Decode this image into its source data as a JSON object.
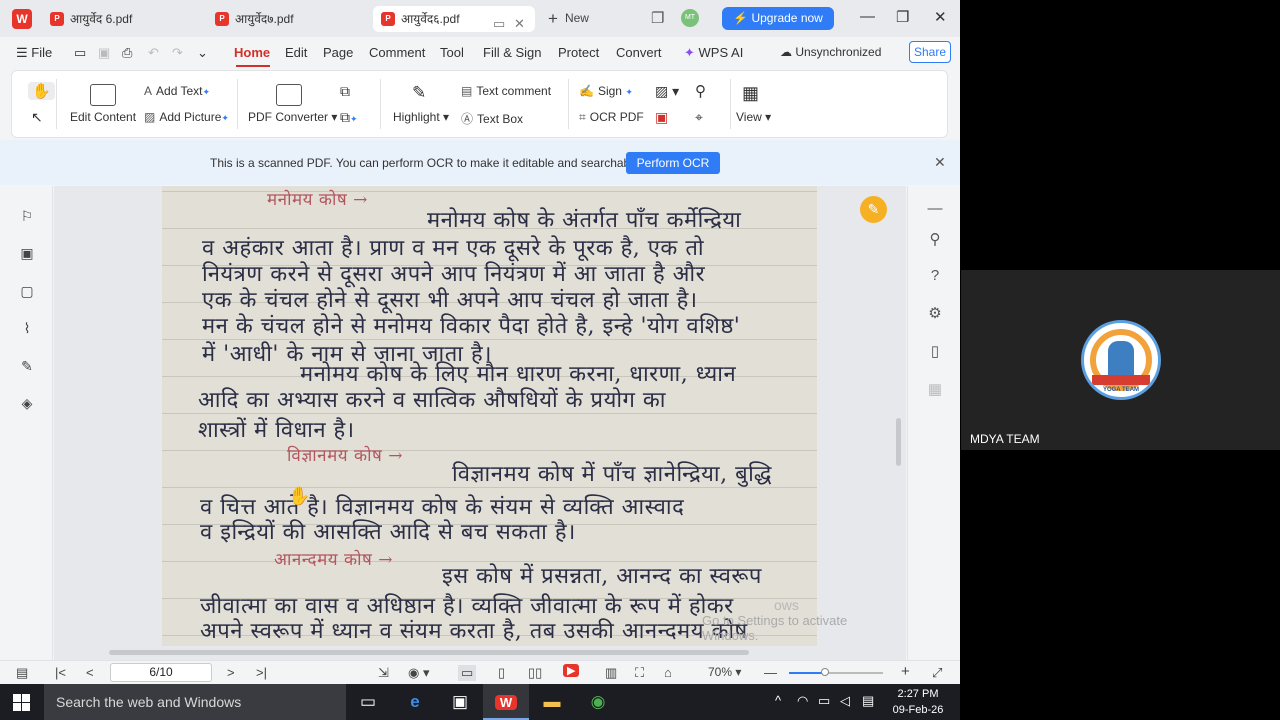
{
  "tabs": [
    {
      "label": "आयुर्वेद 6.pdf"
    },
    {
      "label": "आयुर्वेद७.pdf"
    },
    {
      "label": "आयुर्वेद६.pdf"
    }
  ],
  "new_tab_label": "New",
  "avatar_initials": "MT",
  "upgrade_label": "Upgrade now",
  "menu": {
    "file": "File",
    "items": [
      "Home",
      "Edit",
      "Page",
      "Comment",
      "Tool",
      "Fill & Sign",
      "Protect",
      "Convert"
    ],
    "wps_ai": "WPS AI",
    "sync": "Unsynchronized",
    "share": "Share"
  },
  "ribbon": {
    "edit_content": "Edit Content",
    "add_text": "Add Text",
    "add_picture": "Add Picture",
    "pdf_converter": "PDF Converter",
    "highlight": "Highlight",
    "text_comment": "Text comment",
    "text_box": "Text Box",
    "sign": "Sign",
    "ocr_pdf": "OCR PDF",
    "view": "View"
  },
  "banner": {
    "message": "This is a scanned PDF. You can perform OCR to make it editable and searchable.",
    "button": "Perform OCR"
  },
  "document": {
    "heading_1": "मनोमय कोष →",
    "lines_1": [
      "मनोमय कोष के अंतर्गत पाँच कर्मेन्द्रिया",
      "व अहंकार आता है। प्राण व मन एक दूसरे के पूरक है, एक तो",
      "नियंत्रण करने से दूसरा अपने आप नियंत्रण में आ जाता है और",
      "एक के चंचल होने से दूसरा भी अपने आप चंचल हो जाता है।",
      "मन के चंचल होने से मनोमय विकार पैदा होते है, इन्हे 'योग वशिष्ठ'",
      "में 'आधी' के नाम से जाना जाता है।",
      "मनोमय कोष के लिए मौन धारण करना, धारणा, ध्यान",
      "आदि का अभ्यास करने व सात्विक औषधियों के प्रयोग का",
      "शास्त्रों में विधान है।"
    ],
    "heading_2": "विज्ञानमय कोष →",
    "lines_2": [
      "विज्ञानमय कोष में पाँच ज्ञानेन्द्रिया, बुद्धि",
      "व चित्त आते है। विज्ञानमय कोष के संयम से व्यक्ति आस्वाद",
      "व इन्द्रियों की आसक्ति आदि से बच सकता है।"
    ],
    "heading_3": "आनन्दमय कोष →",
    "lines_3": [
      "इस कोष में प्रसन्नता, आनन्द का स्वरूप",
      "जीवात्मा का वास व अधिष्ठान है। व्यक्ति जीवात्मा के रूप में होकर",
      "अपने स्वरूप में ध्यान व संयम करता है, तब उसकी आनन्दमय कोष"
    ]
  },
  "watermark": {
    "line1": "ows",
    "line2": "Go to Settings to activate Windows."
  },
  "status": {
    "page": "6/10",
    "zoom": "70%",
    "zoom_fraction": 0.38
  },
  "meeting": {
    "participant_name": "MDYA TEAM",
    "logo_caption": "YOGA TEAM"
  },
  "taskbar": {
    "search_placeholder": "Search the web and Windows",
    "time": "2:27 PM",
    "date": "09-Feb-26"
  },
  "colors": {
    "accent": "#2f7cf6",
    "brand_red": "#d2302a",
    "upgrade": "#2f7cf6"
  }
}
